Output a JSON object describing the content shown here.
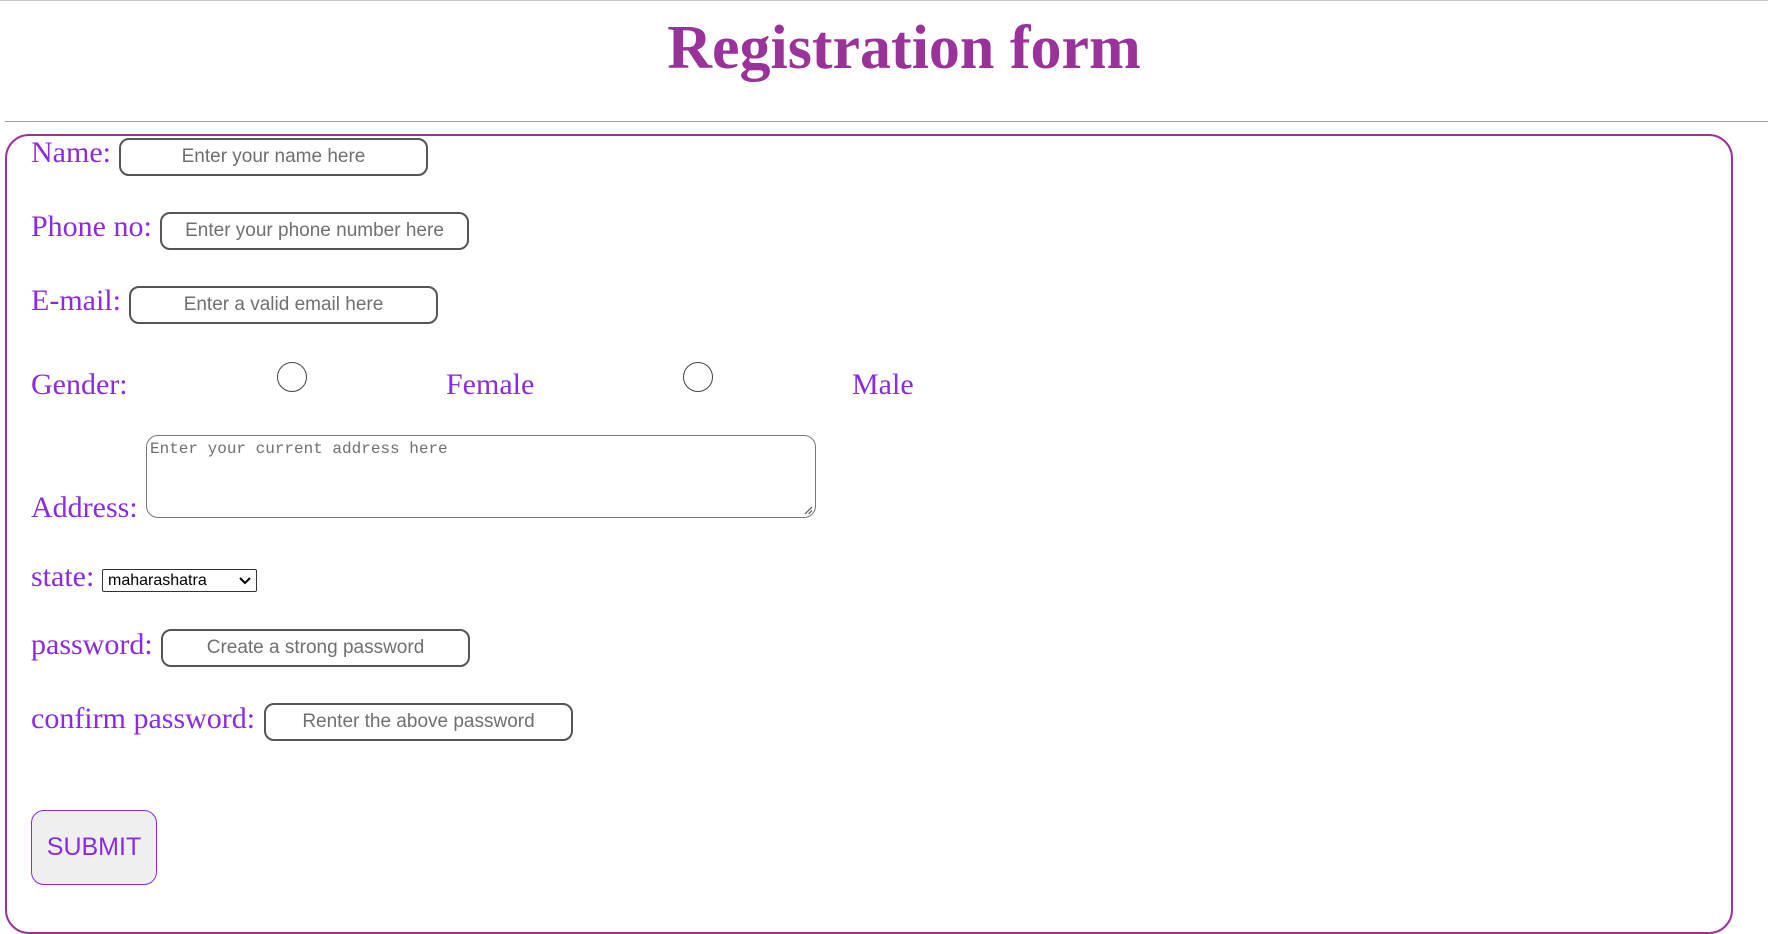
{
  "header": {
    "title": "Registration form"
  },
  "form": {
    "name": {
      "label": "Name:",
      "placeholder": "Enter your name here",
      "value": ""
    },
    "phone": {
      "label": "Phone no:",
      "placeholder": "Enter your phone number here",
      "value": ""
    },
    "email": {
      "label": "E-mail:",
      "placeholder": "Enter a valid email here",
      "value": ""
    },
    "gender": {
      "label": "Gender:",
      "options": [
        {
          "label": "Female",
          "checked": false
        },
        {
          "label": "Male",
          "checked": false
        }
      ]
    },
    "address": {
      "label": "Address:",
      "placeholder": "Enter your current address here",
      "value": ""
    },
    "state": {
      "label": "state:",
      "selected": "maharashatra"
    },
    "password": {
      "label": "password:",
      "placeholder": "Create a strong password",
      "value": ""
    },
    "confirm_password": {
      "label": "confirm password:",
      "placeholder": "Renter the above password",
      "value": ""
    },
    "submit_label": "SUBMIT"
  },
  "colors": {
    "title": "#993399",
    "label": "#8a2be2",
    "form_border": "#993399"
  }
}
